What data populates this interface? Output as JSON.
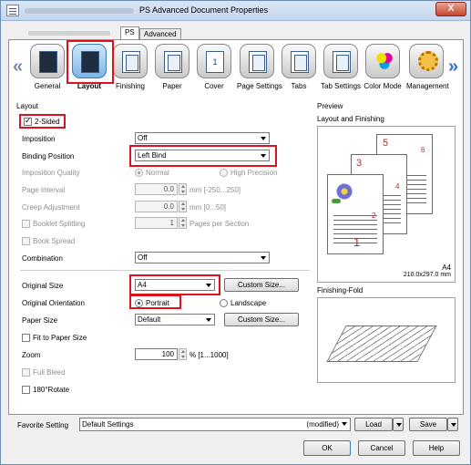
{
  "window": {
    "title": "PS Advanced Document Properties",
    "close_label": "X"
  },
  "tabs": {
    "ps": "PS",
    "advanced": "Advanced"
  },
  "categories": [
    {
      "label": "General",
      "icon": "printer-general-icon"
    },
    {
      "label": "Layout",
      "icon": "layout-icon",
      "selected": true
    },
    {
      "label": "Finishing",
      "icon": "finishing-icon"
    },
    {
      "label": "Paper",
      "icon": "paper-icon"
    },
    {
      "label": "Cover",
      "icon": "cover-icon"
    },
    {
      "label": "Page Settings",
      "icon": "page-settings-icon"
    },
    {
      "label": "Tabs",
      "icon": "tabs-icon"
    },
    {
      "label": "Tab Settings",
      "icon": "tab-settings-icon"
    },
    {
      "label": "Color Mode",
      "icon": "color-mode-icon"
    },
    {
      "label": "Management",
      "icon": "management-icon"
    }
  ],
  "layout": {
    "group_title": "Layout",
    "two_sided": {
      "label": "2-Sided",
      "checked": true
    },
    "imposition": {
      "label": "Imposition",
      "value": "Off"
    },
    "binding_position": {
      "label": "Binding Position",
      "value": "Left Bind"
    },
    "imposition_quality": {
      "label": "Imposition Quality",
      "normal": "Normal",
      "high": "High Precision"
    },
    "page_interval": {
      "label": "Page Interval",
      "value": "0.0",
      "unit": "mm [-250...250]"
    },
    "creep_adjustment": {
      "label": "Creep Adjustment",
      "value": "0.0",
      "unit": "mm [0...50]"
    },
    "booklet_splitting": {
      "label": "Booklet Splitting",
      "value": "1",
      "unit": "Pages per Section"
    },
    "book_spread": {
      "label": "Book Spread"
    },
    "combination": {
      "label": "Combination",
      "value": "Off"
    },
    "original_size": {
      "label": "Original Size",
      "value": "A4",
      "button": "Custom Size..."
    },
    "original_orientation": {
      "label": "Original Orientation",
      "portrait": "Portrait",
      "landscape": "Landscape"
    },
    "paper_size": {
      "label": "Paper Size",
      "value": "Default",
      "button": "Custom Size..."
    },
    "fit_to_paper": {
      "label": "Fit to Paper Size"
    },
    "zoom": {
      "label": "Zoom",
      "value": "100",
      "unit": "% [1...1000]"
    },
    "full_bleed": {
      "label": "Full Bleed"
    },
    "rotate_180": {
      "label": "180°Rotate"
    }
  },
  "preview": {
    "group_title": "Preview",
    "caption": "Layout and Finishing",
    "page_numbers": [
      "1",
      "2",
      "3",
      "4",
      "5",
      "6"
    ],
    "paper_name": "A4",
    "paper_dims": "210.0x297.0 mm",
    "fold_title": "Finishing-Fold"
  },
  "favorite": {
    "label": "Favorite Setting",
    "value": "Default Settings",
    "status": "(modified)",
    "load": "Load",
    "save": "Save"
  },
  "footer": {
    "ok": "OK",
    "cancel": "Cancel",
    "help": "Help"
  },
  "colors": {
    "highlight": "#d9141e",
    "selected_tab": "#7bb6e6"
  }
}
